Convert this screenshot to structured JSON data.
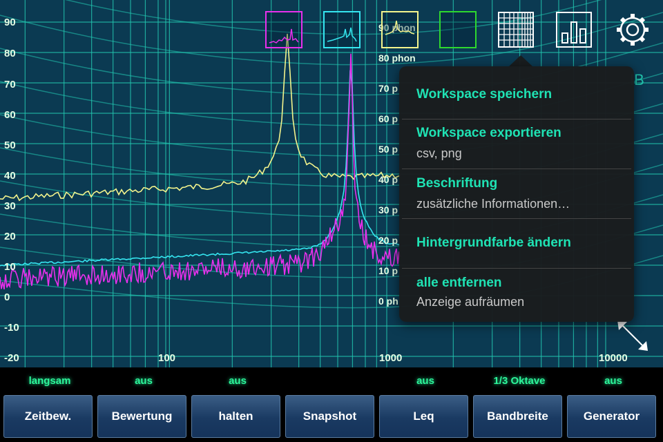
{
  "graph": {
    "y_ticks": [
      "90",
      "80",
      "70",
      "60",
      "50",
      "40",
      "30",
      "20",
      "10",
      "0",
      "-10",
      "-20"
    ],
    "x_ticks": [
      "100",
      "1000",
      "10000"
    ],
    "phon_labels": [
      "90 phon",
      "80 phon",
      "70 p",
      "60 p",
      "50 p",
      "40 p",
      "30 p",
      "20 p",
      "10 p",
      "0 ph"
    ],
    "partial_label": "IB",
    "colors": {
      "background": "#0b3a52",
      "grid": "#22c7b0",
      "yellow": "#f4f48c",
      "cyan": "#35e6f0",
      "magenta": "#e830ec",
      "green": "#2ed82e"
    }
  },
  "toolbar": {
    "thumbnails": [
      {
        "name": "magenta-trace",
        "color": "#e830ec"
      },
      {
        "name": "cyan-trace",
        "color": "#35e6f0"
      },
      {
        "name": "yellow-trace",
        "color": "#f4f48c"
      },
      {
        "name": "green-trace",
        "color": "#2ed82e"
      }
    ],
    "icons": [
      "grid-icon",
      "bar-chart-icon",
      "gear-icon"
    ]
  },
  "menu": {
    "items": [
      {
        "title": "Workspace speichern",
        "subtitle": ""
      },
      {
        "title": "Workspace exportieren",
        "subtitle": "csv, png"
      },
      {
        "title": "Beschriftung",
        "subtitle": "zusätzliche Informationen…"
      },
      {
        "title": "Hintergrundfarbe ändern",
        "subtitle": ""
      },
      {
        "title": "alle entfernen",
        "subtitle": "Anzeige aufräumen"
      }
    ]
  },
  "controls": [
    {
      "status": "langsam",
      "label": "Zeitbew."
    },
    {
      "status": "aus",
      "label": "Bewertung"
    },
    {
      "status": "aus",
      "label": "halten"
    },
    {
      "status": "",
      "label": "Snapshot"
    },
    {
      "status": "aus",
      "label": "Leq"
    },
    {
      "status": "1/3 Oktave",
      "label": "Bandbreite"
    },
    {
      "status": "aus",
      "label": "Generator"
    }
  ]
}
